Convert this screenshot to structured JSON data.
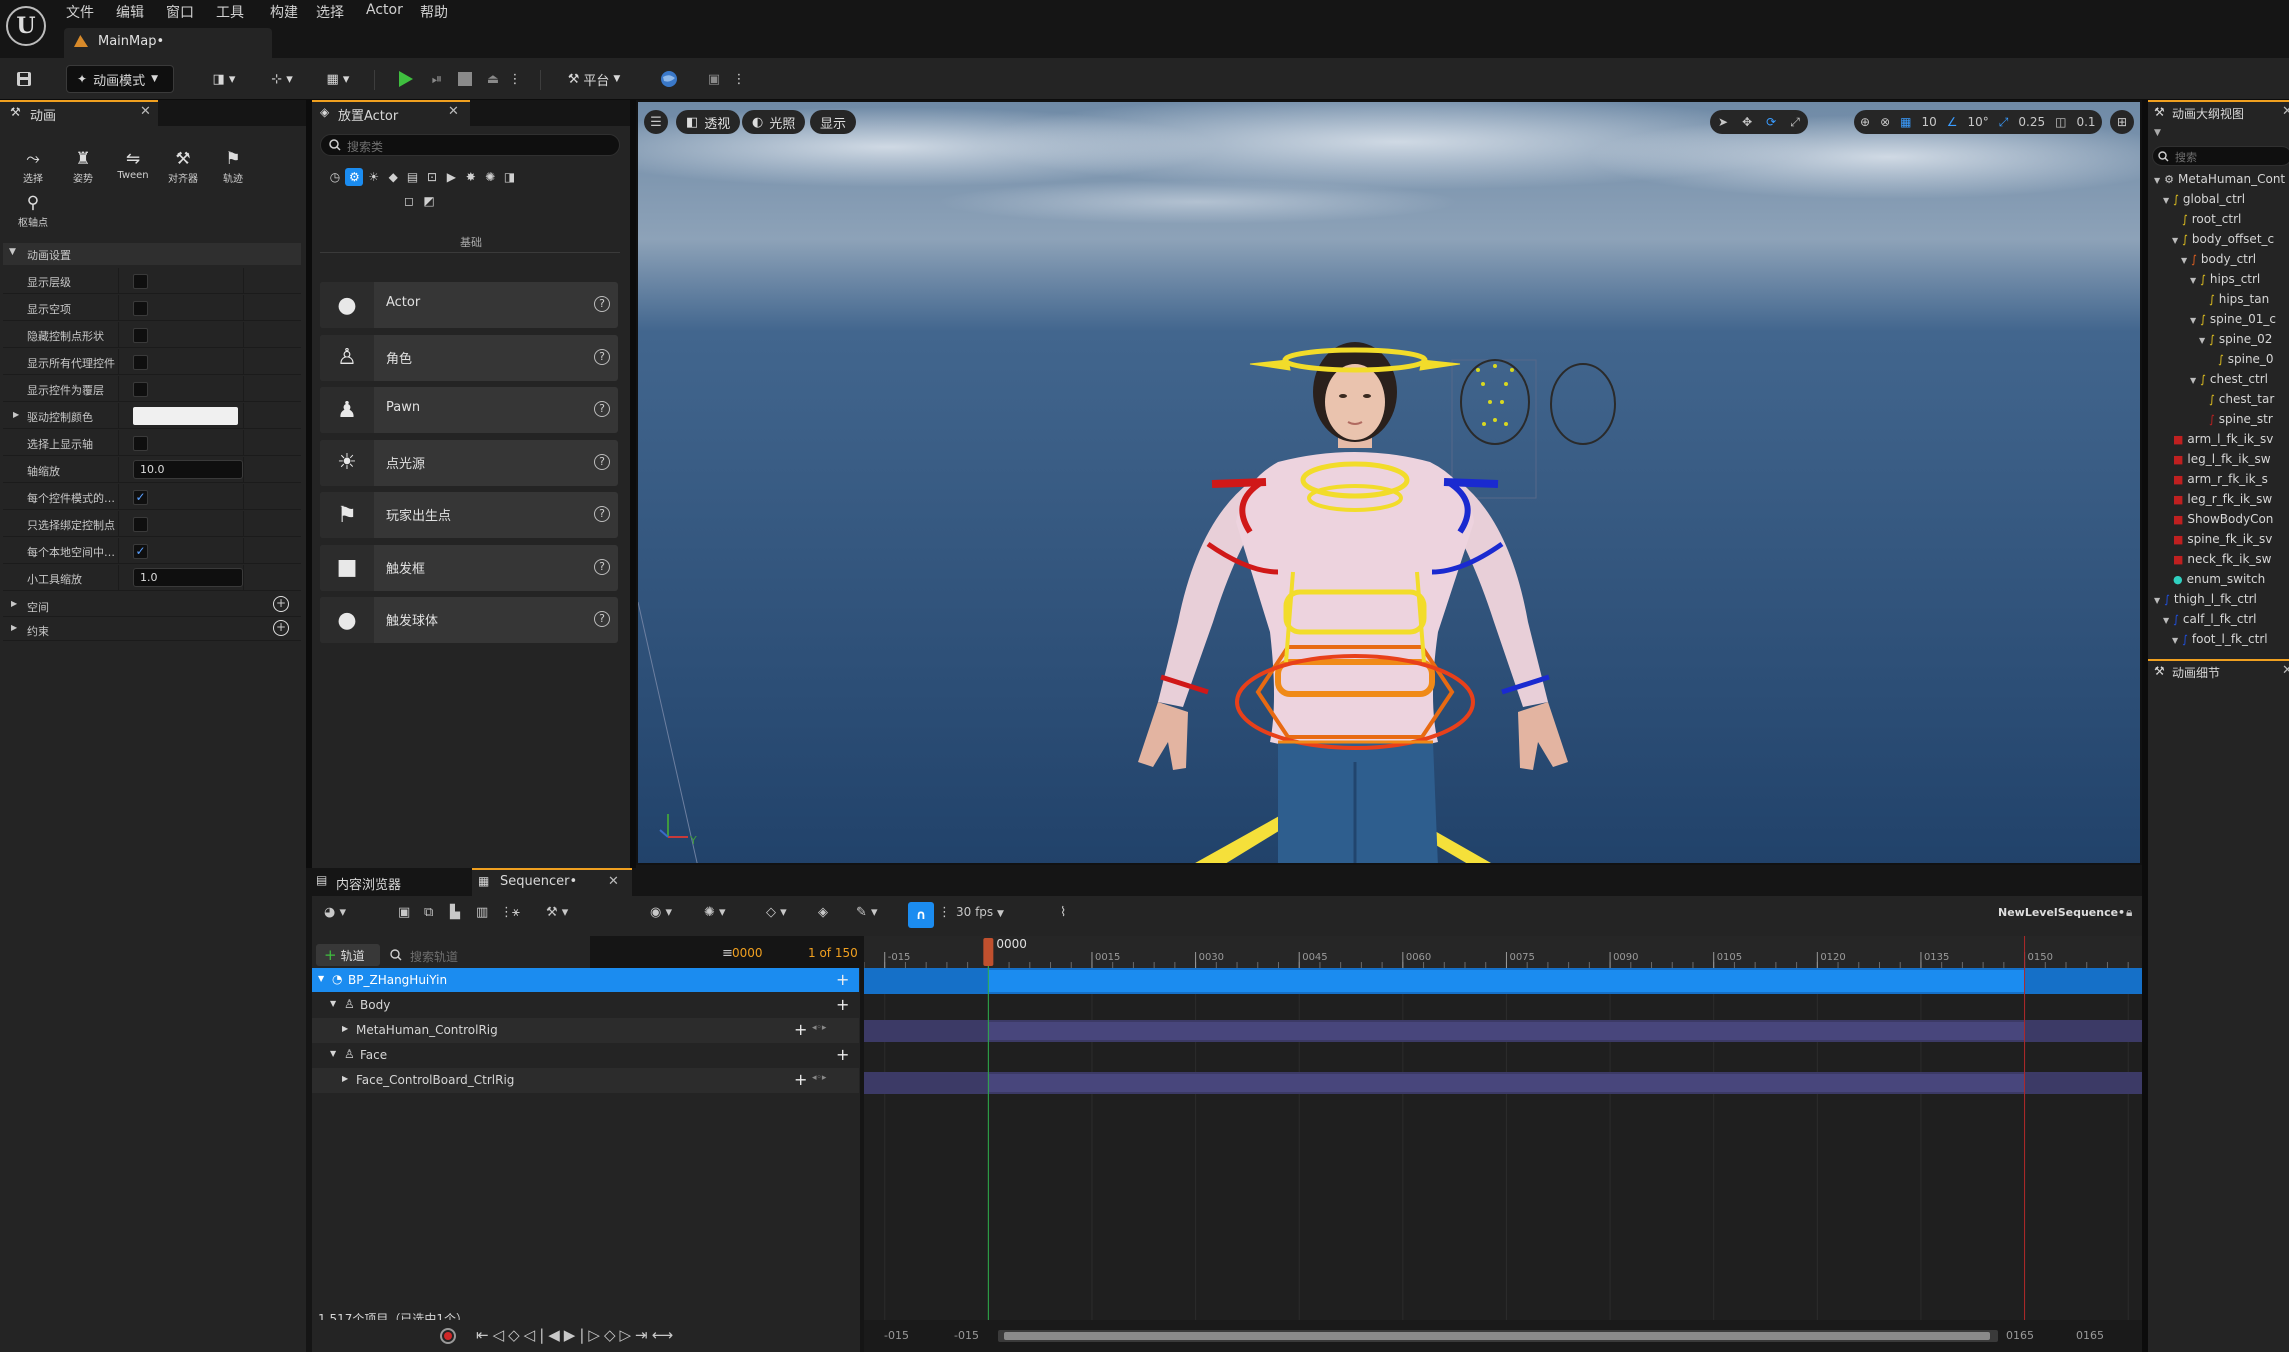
{
  "menu": [
    "文件",
    "编辑",
    "窗口",
    "工具",
    "构建",
    "选择",
    "Actor",
    "帮助"
  ],
  "map_tab": "MainMap•",
  "toolbar": {
    "mode_label": "动画模式",
    "platform_label": "平台"
  },
  "anim_panel": {
    "tab": "动画",
    "tools": [
      {
        "icon": "select-icon",
        "glyph": "⤳",
        "label": "选择"
      },
      {
        "icon": "pose-icon",
        "glyph": "♜",
        "label": "姿势"
      },
      {
        "icon": "tween-icon",
        "glyph": "⇋",
        "label": "Tween"
      },
      {
        "icon": "aligner-icon",
        "glyph": "⚒",
        "label": "对齐器"
      },
      {
        "icon": "path-icon",
        "glyph": "⚑",
        "label": "轨迹"
      },
      {
        "icon": "pivot-icon",
        "glyph": "⚲",
        "label": "枢轴点"
      }
    ],
    "section_title": "动画设置",
    "rows": [
      {
        "label": "显示层级",
        "kind": "checkbox",
        "checked": false
      },
      {
        "label": "显示空项",
        "kind": "checkbox",
        "checked": false
      },
      {
        "label": "隐藏控制点形状",
        "kind": "checkbox",
        "checked": false
      },
      {
        "label": "显示所有代理控件",
        "kind": "checkbox",
        "checked": false
      },
      {
        "label": "显示控件为覆层",
        "kind": "checkbox",
        "checked": false
      },
      {
        "label": "驱动控制颜色",
        "kind": "color",
        "checked": false
      },
      {
        "label": "选择上显示轴",
        "kind": "checkbox",
        "checked": false
      },
      {
        "label": "轴缩放",
        "kind": "number",
        "value": "10.0"
      },
      {
        "label": "每个控件模式的…",
        "kind": "checkbox",
        "checked": true
      },
      {
        "label": "只选择绑定控制点",
        "kind": "checkbox",
        "checked": false
      },
      {
        "label": "每个本地空间中…",
        "kind": "checkbox",
        "checked": true
      },
      {
        "label": "小工具缩放",
        "kind": "number",
        "value": "1.0"
      }
    ],
    "sub_sections": [
      "空间",
      "约束"
    ]
  },
  "place_actor": {
    "tab": "放置Actor",
    "search_placeholder": "搜索类",
    "category": "基础",
    "items": [
      {
        "name": "Actor",
        "icon": "sphere-icon",
        "glyph": "●"
      },
      {
        "name": "角色",
        "icon": "character-icon",
        "glyph": "♙"
      },
      {
        "name": "Pawn",
        "icon": "pawn-icon",
        "glyph": "♟"
      },
      {
        "name": "点光源",
        "icon": "light-bulb-icon",
        "glyph": "☀"
      },
      {
        "name": "玩家出生点",
        "icon": "player-start-icon",
        "glyph": "⚑"
      },
      {
        "name": "触发框",
        "icon": "trigger-box-icon",
        "glyph": "■"
      },
      {
        "name": "触发球体",
        "icon": "trigger-sphere-icon",
        "glyph": "●"
      }
    ]
  },
  "viewport": {
    "perspective": "透视",
    "lighting": "光照",
    "show": "显示",
    "grid_snap": "10",
    "rot_snap": "10°",
    "scale_snap": "0.25",
    "camera_speed": "0.1"
  },
  "outliner": {
    "tab": "动画大纲视图",
    "search_placeholder": "搜索",
    "rows": [
      {
        "label": "MetaHuman_Cont",
        "depth": 0,
        "arrow": "▼",
        "color": "#d0d0d0",
        "icon": "⚙"
      },
      {
        "label": "global_ctrl",
        "depth": 1,
        "arrow": "▼",
        "color": "#e0c020",
        "icon": "∫"
      },
      {
        "label": "root_ctrl",
        "depth": 2,
        "arrow": "",
        "color": "#e0c020",
        "icon": "∫"
      },
      {
        "label": "body_offset_c",
        "depth": 2,
        "arrow": "▼",
        "color": "#e0c020",
        "icon": "∫"
      },
      {
        "label": "body_ctrl",
        "depth": 3,
        "arrow": "▼",
        "color": "#e06020",
        "icon": "∫"
      },
      {
        "label": "hips_ctrl",
        "depth": 4,
        "arrow": "▼",
        "color": "#e0c020",
        "icon": "∫"
      },
      {
        "label": "hips_tan",
        "depth": 5,
        "arrow": "",
        "color": "#e0c020",
        "icon": "∫"
      },
      {
        "label": "spine_01_c",
        "depth": 4,
        "arrow": "▼",
        "color": "#e0c020",
        "icon": "∫"
      },
      {
        "label": "spine_02",
        "depth": 5,
        "arrow": "▼",
        "color": "#e0c020",
        "icon": "∫"
      },
      {
        "label": "spine_0",
        "depth": 6,
        "arrow": "",
        "color": "#e0c020",
        "icon": "∫"
      },
      {
        "label": "chest_ctrl",
        "depth": 4,
        "arrow": "▼",
        "color": "#e0c020",
        "icon": "∫"
      },
      {
        "label": "chest_tar",
        "depth": 5,
        "arrow": "",
        "color": "#e0c020",
        "icon": "∫"
      },
      {
        "label": "spine_str",
        "depth": 5,
        "arrow": "",
        "color": "#c02020",
        "icon": "∫"
      },
      {
        "label": "arm_l_fk_ik_sv",
        "depth": 1,
        "arrow": "",
        "color": "#c02020",
        "icon": "■"
      },
      {
        "label": "leg_l_fk_ik_sw",
        "depth": 1,
        "arrow": "",
        "color": "#c02020",
        "icon": "■"
      },
      {
        "label": "arm_r_fk_ik_s",
        "depth": 1,
        "arrow": "",
        "color": "#c02020",
        "icon": "■"
      },
      {
        "label": "leg_r_fk_ik_sw",
        "depth": 1,
        "arrow": "",
        "color": "#c02020",
        "icon": "■"
      },
      {
        "label": "ShowBodyCon",
        "depth": 1,
        "arrow": "",
        "color": "#c02020",
        "icon": "■"
      },
      {
        "label": "spine_fk_ik_sv",
        "depth": 1,
        "arrow": "",
        "color": "#c02020",
        "icon": "■"
      },
      {
        "label": "neck_fk_ik_sw",
        "depth": 1,
        "arrow": "",
        "color": "#c02020",
        "icon": "■"
      },
      {
        "label": "enum_switch",
        "depth": 1,
        "arrow": "",
        "color": "#30d0c0",
        "icon": "●"
      },
      {
        "label": "thigh_l_fk_ctrl",
        "depth": 0,
        "arrow": "▼",
        "color": "#2050e0",
        "icon": "∫"
      },
      {
        "label": "calf_l_fk_ctrl",
        "depth": 1,
        "arrow": "▼",
        "color": "#2050e0",
        "icon": "∫"
      },
      {
        "label": "foot_l_fk_ctrl",
        "depth": 2,
        "arrow": "▼",
        "color": "#2050e0",
        "icon": "∫"
      }
    ],
    "details_tab": "动画细节"
  },
  "bottom": {
    "content_browser_tab": "内容浏览器",
    "sequencer_tab": "Sequencer•",
    "fps": "30 fps",
    "sequence_name": "NewLevelSequence•",
    "add_track": "轨道",
    "search_placeholder": "搜索轨道",
    "current_frame": "0000",
    "frame_count": "1 of 150",
    "playhead_label": "0000",
    "ruler_ticks": [
      {
        "label": "-015",
        "frame": -15
      },
      {
        "label": "0015",
        "frame": 15
      },
      {
        "label": "0030",
        "frame": 30
      },
      {
        "label": "0045",
        "frame": 45
      },
      {
        "label": "0060",
        "frame": 60
      },
      {
        "label": "0075",
        "frame": 75
      },
      {
        "label": "0090",
        "frame": 90
      },
      {
        "label": "0105",
        "frame": 105
      },
      {
        "label": "0120",
        "frame": 120
      },
      {
        "label": "0135",
        "frame": 135
      },
      {
        "label": "0150",
        "frame": 150
      }
    ],
    "tracks": [
      {
        "label": "BP_ZHangHuiYin",
        "level": 0,
        "selected": true,
        "icon": "actor-icon"
      },
      {
        "label": "Body",
        "level": 1,
        "selected": false,
        "icon": "skeleton-icon"
      },
      {
        "label": "MetaHuman_ControlRig",
        "level": 2,
        "selected": false,
        "icon": ""
      },
      {
        "label": "Face",
        "level": 1,
        "selected": false,
        "icon": "skeleton-icon"
      },
      {
        "label": "Face_ControlBoard_CtrlRig",
        "level": 2,
        "selected": false,
        "icon": ""
      }
    ],
    "item_count": "1,517个项目（已选中1个）",
    "range_start_a": "-015",
    "range_start_b": "-015",
    "range_end_a": "0165",
    "range_end_b": "0165"
  },
  "colors": {
    "accent": "#0e86e8",
    "selection": "#1b8cf0",
    "track_bar": "#48467c",
    "playhead": "#c0502e",
    "end_marker": "#b02828"
  }
}
